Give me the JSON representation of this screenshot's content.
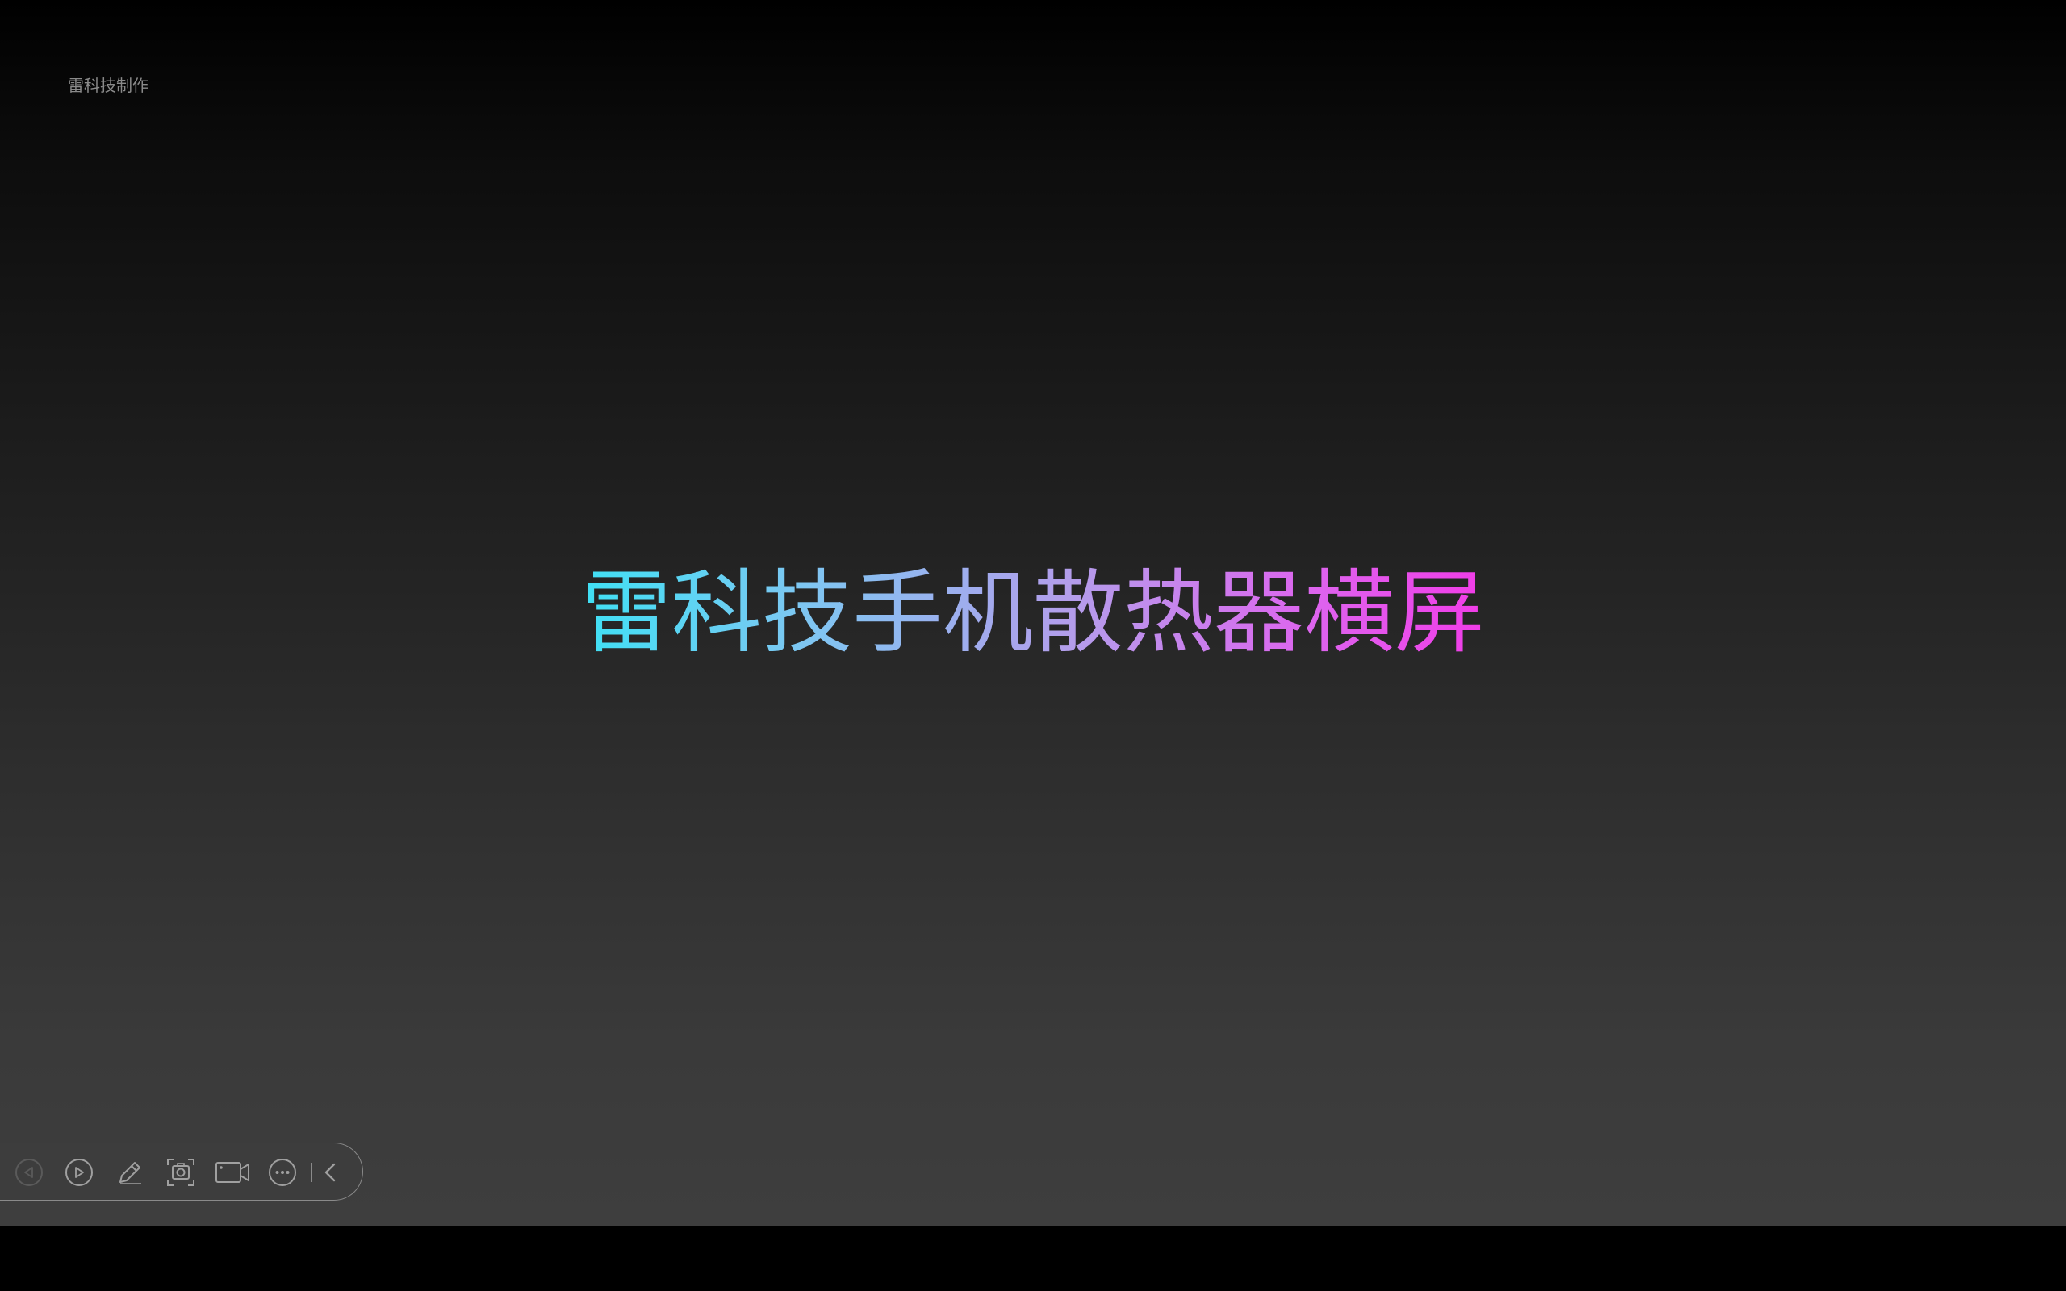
{
  "watermark": "雷科技制作",
  "slide": {
    "title": "雷科技手机散热器横屏",
    "title_gradient_colors": [
      "#3fe0f4",
      "#b59ceb",
      "#f13ce8"
    ]
  },
  "toolbar": {
    "buttons": [
      {
        "name": "previous-button",
        "icon": "triangle-left-circle-icon",
        "enabled": false
      },
      {
        "name": "next-button",
        "icon": "triangle-right-circle-icon",
        "enabled": true
      },
      {
        "name": "pen-button",
        "icon": "pencil-icon",
        "enabled": true
      },
      {
        "name": "screenshot-button",
        "icon": "screenshot-frame-icon",
        "enabled": true
      },
      {
        "name": "record-button",
        "icon": "video-camera-icon",
        "enabled": true
      },
      {
        "name": "more-button",
        "icon": "ellipsis-circle-icon",
        "enabled": true
      },
      {
        "name": "collapse-button",
        "icon": "chevron-left-icon",
        "enabled": true
      }
    ]
  }
}
